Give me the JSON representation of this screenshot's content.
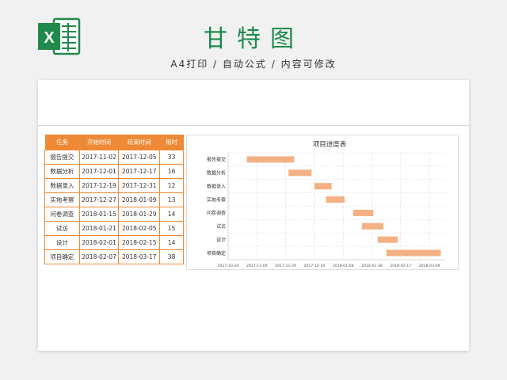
{
  "header": {
    "title": "甘特图",
    "subtitle": "A4打印 / 自动公式 / 内容可修改"
  },
  "table": {
    "headers": [
      "任务",
      "开始时间",
      "结束时间",
      "用时"
    ],
    "rows": [
      [
        "报告提交",
        "2017-11-02",
        "2017-12-05",
        "33"
      ],
      [
        "数据分析",
        "2017-12-01",
        "2017-12-17",
        "16"
      ],
      [
        "数据录入",
        "2017-12-19",
        "2017-12-31",
        "12"
      ],
      [
        "实地考察",
        "2017-12-27",
        "2018-01-09",
        "13"
      ],
      [
        "问卷调查",
        "2018-01-15",
        "2018-01-29",
        "14"
      ],
      [
        "试访",
        "2018-01-21",
        "2018-02-05",
        "15"
      ],
      [
        "设计",
        "2018-02-01",
        "2018-02-15",
        "14"
      ],
      [
        "项目确定",
        "2018-02-07",
        "2018-03-17",
        "38"
      ]
    ]
  },
  "chart_data": {
    "type": "bar",
    "orientation": "horizontal-gantt",
    "title": "项目进度表",
    "categories": [
      "报告提交",
      "数据分析",
      "数据录入",
      "实地考察",
      "问卷调查",
      "试访",
      "设计",
      "项目确定"
    ],
    "start": [
      "2017-11-02",
      "2017-12-01",
      "2017-12-19",
      "2017-12-27",
      "2018-01-15",
      "2018-01-21",
      "2018-02-01",
      "2018-02-07"
    ],
    "end": [
      "2017-12-05",
      "2017-12-17",
      "2017-12-31",
      "2018-01-09",
      "2018-01-29",
      "2018-02-05",
      "2018-02-15",
      "2018-03-17"
    ],
    "x_ticks": [
      "2017-10-20",
      "2017-11-09",
      "2017-11-29",
      "2017-12-19",
      "2018-01-08",
      "2018-01-28",
      "2018-02-17",
      "2018-03-09"
    ],
    "xlim": [
      "2017-10-20",
      "2018-03-20"
    ],
    "grid": true,
    "bar_color": "#f4b183"
  },
  "colors": {
    "accent": "#ee8a36",
    "brand": "#1f8a4c"
  },
  "icons": {
    "logo": "excel-logo-icon"
  }
}
